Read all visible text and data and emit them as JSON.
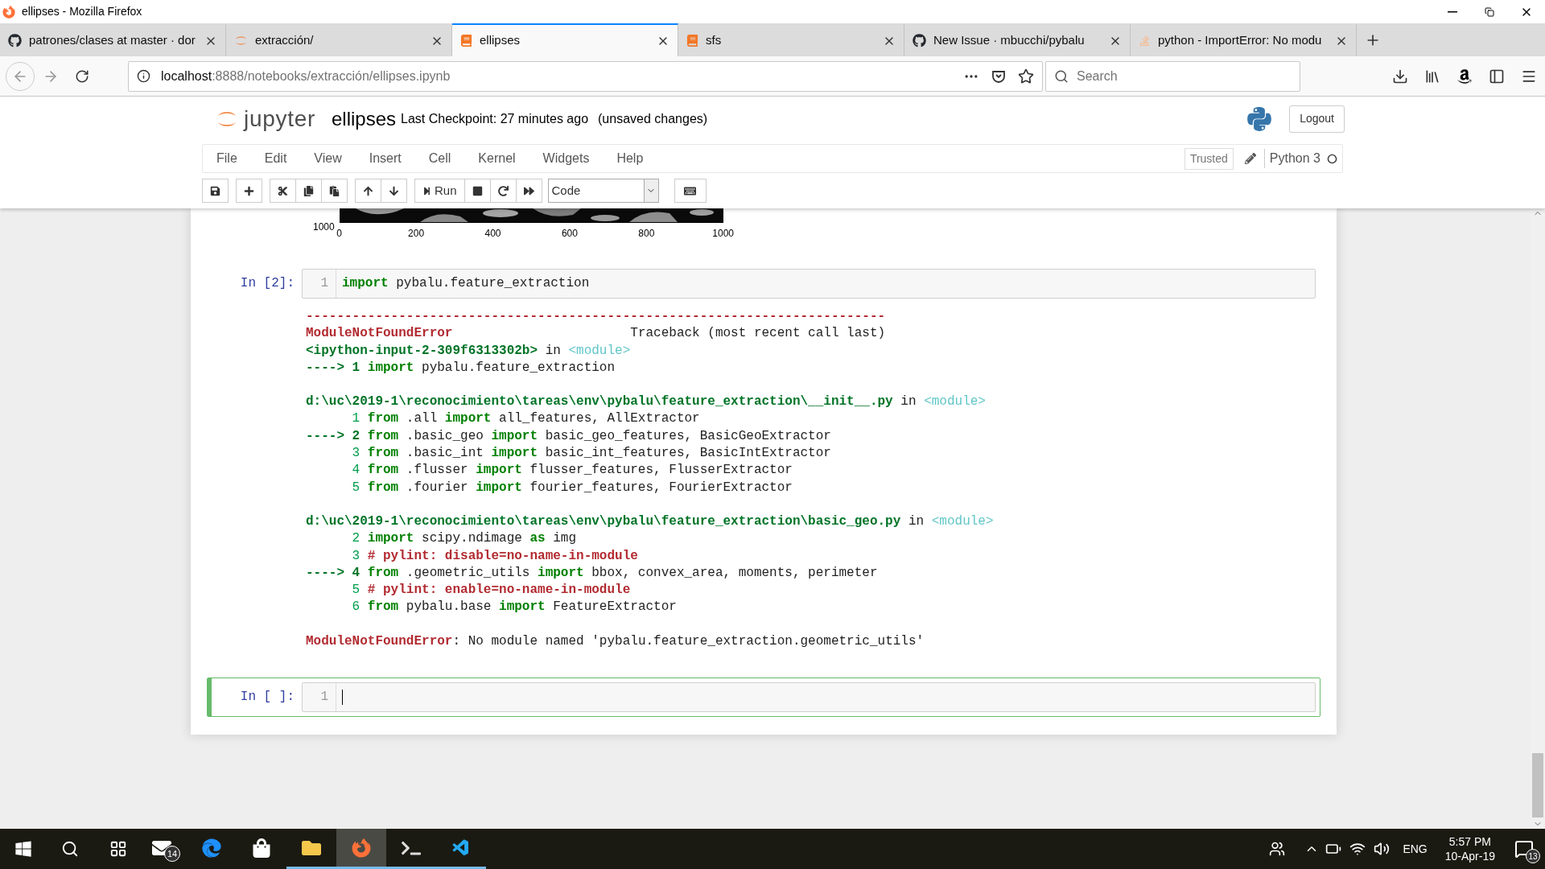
{
  "window": {
    "title": "ellipses - Mozilla Firefox"
  },
  "tabs": [
    {
      "label": "patrones/clases at master · dor",
      "kind": "github",
      "selected": false
    },
    {
      "label": "extracción/",
      "kind": "jupyter",
      "selected": false
    },
    {
      "label": "ellipses",
      "kind": "book",
      "selected": true
    },
    {
      "label": "sfs",
      "kind": "book",
      "selected": false
    },
    {
      "label": "New Issue · mbucchi/pybalu",
      "kind": "github",
      "selected": false
    },
    {
      "label": "python - ImportError: No modu",
      "kind": "stack",
      "selected": false
    }
  ],
  "address_bar": {
    "host": "localhost",
    "path": ":8888/notebooks/extracción/ellipses.ipynb"
  },
  "search": {
    "placeholder": "Search"
  },
  "notebook": {
    "logo": "jupyter",
    "name": "ellipses",
    "checkpoint": "Last Checkpoint: 27 minutes ago",
    "status": "(unsaved changes)",
    "logout": "Logout"
  },
  "menu": [
    "File",
    "Edit",
    "View",
    "Insert",
    "Cell",
    "Kernel",
    "Widgets",
    "Help"
  ],
  "trusted": "Trusted",
  "kernel": "Python 3",
  "toolbar": {
    "run": "Run",
    "cell_type": "Code"
  },
  "plot_axis": {
    "y_tick": "1000",
    "x_ticks": [
      "0",
      "200",
      "400",
      "600",
      "800",
      "1000"
    ]
  },
  "cells": [
    {
      "prompt": "In [2]:",
      "selected": false,
      "lines": [
        {
          "number": "1",
          "tokens": [
            {
              "text": "import",
              "kind": "keyword"
            },
            {
              "text": " pybalu.feature_extraction",
              "kind": "plain"
            }
          ]
        }
      ],
      "output": [
        [
          [
            {
              "text": "---------------------------------------------------------------------------",
              "kind": "error"
            }
          ],
          [
            {
              "text": "ModuleNotFoundError",
              "kind": "error"
            },
            {
              "text": "                       Traceback (most recent call last)",
              "kind": "plain"
            }
          ],
          [
            {
              "text": "<ipython-input-2-309f6313302b>",
              "kind": "frame"
            },
            {
              "text": " in ",
              "kind": "plain"
            },
            {
              "text": "<module>",
              "kind": "module"
            }
          ],
          [
            {
              "text": "----> 1 ",
              "kind": "frame"
            },
            {
              "text": "import",
              "kind": "keyword"
            },
            {
              "text": " pybalu.feature_extraction",
              "kind": "plain"
            }
          ]
        ],
        [
          [
            {
              "text": "d:\\uc\\2019-1\\reconocimiento\\tareas\\env\\pybalu\\feature_extraction\\__init__.py",
              "kind": "frame"
            },
            {
              "text": " in ",
              "kind": "plain"
            },
            {
              "text": "<module>",
              "kind": "module"
            }
          ],
          [
            {
              "text": "      1 ",
              "kind": "lineno"
            },
            {
              "text": "from",
              "kind": "keyword"
            },
            {
              "text": " .all ",
              "kind": "plain"
            },
            {
              "text": "import",
              "kind": "keyword"
            },
            {
              "text": " all_features, AllExtractor",
              "kind": "plain"
            }
          ],
          [
            {
              "text": "----> 2 ",
              "kind": "frame"
            },
            {
              "text": "from",
              "kind": "keyword"
            },
            {
              "text": " .basic_geo ",
              "kind": "plain"
            },
            {
              "text": "import",
              "kind": "keyword"
            },
            {
              "text": " basic_geo_features, BasicGeoExtractor",
              "kind": "plain"
            }
          ],
          [
            {
              "text": "      3 ",
              "kind": "lineno"
            },
            {
              "text": "from",
              "kind": "keyword"
            },
            {
              "text": " .basic_int ",
              "kind": "plain"
            },
            {
              "text": "import",
              "kind": "keyword"
            },
            {
              "text": " basic_int_features, BasicIntExtractor",
              "kind": "plain"
            }
          ],
          [
            {
              "text": "      4 ",
              "kind": "lineno"
            },
            {
              "text": "from",
              "kind": "keyword"
            },
            {
              "text": " .flusser ",
              "kind": "plain"
            },
            {
              "text": "import",
              "kind": "keyword"
            },
            {
              "text": " flusser_features, FlusserExtractor",
              "kind": "plain"
            }
          ],
          [
            {
              "text": "      5 ",
              "kind": "lineno"
            },
            {
              "text": "from",
              "kind": "keyword"
            },
            {
              "text": " .fourier ",
              "kind": "plain"
            },
            {
              "text": "import",
              "kind": "keyword"
            },
            {
              "text": " fourier_features, FourierExtractor",
              "kind": "plain"
            }
          ]
        ],
        [
          [
            {
              "text": "d:\\uc\\2019-1\\reconocimiento\\tareas\\env\\pybalu\\feature_extraction\\basic_geo.py",
              "kind": "frame"
            },
            {
              "text": " in ",
              "kind": "plain"
            },
            {
              "text": "<module>",
              "kind": "module"
            }
          ],
          [
            {
              "text": "      2 ",
              "kind": "lineno"
            },
            {
              "text": "import",
              "kind": "keyword"
            },
            {
              "text": " scipy.ndimage ",
              "kind": "plain"
            },
            {
              "text": "as",
              "kind": "keyword"
            },
            {
              "text": " img",
              "kind": "plain"
            }
          ],
          [
            {
              "text": "      3 ",
              "kind": "lineno"
            },
            {
              "text": "# pylint: disable=no-name-in-module",
              "kind": "error"
            }
          ],
          [
            {
              "text": "----> 4 ",
              "kind": "frame"
            },
            {
              "text": "from",
              "kind": "keyword"
            },
            {
              "text": " .geometric_utils ",
              "kind": "plain"
            },
            {
              "text": "import",
              "kind": "keyword"
            },
            {
              "text": " bbox, convex_area, moments, perimeter",
              "kind": "plain"
            }
          ],
          [
            {
              "text": "      5 ",
              "kind": "lineno"
            },
            {
              "text": "# pylint: enable=no-name-in-module",
              "kind": "error"
            }
          ],
          [
            {
              "text": "      6 ",
              "kind": "lineno"
            },
            {
              "text": "from",
              "kind": "keyword"
            },
            {
              "text": " pybalu.base ",
              "kind": "plain"
            },
            {
              "text": "import",
              "kind": "keyword"
            },
            {
              "text": " FeatureExtractor",
              "kind": "plain"
            }
          ]
        ],
        [
          [
            {
              "text": "ModuleNotFoundError",
              "kind": "error"
            },
            {
              "text": ": No module named 'pybalu.feature_extraction.geometric_utils'",
              "kind": "plain"
            }
          ]
        ]
      ]
    },
    {
      "prompt": "In [ ]:",
      "selected": true,
      "lines": [
        {
          "number": "1"
        }
      ]
    }
  ],
  "taskbar": {
    "apps": [
      {
        "kind": "mail",
        "badge": "14",
        "running": false,
        "selected": false
      },
      {
        "kind": "edge",
        "running": false,
        "selected": false
      },
      {
        "kind": "store",
        "running": false,
        "selected": false
      },
      {
        "kind": "folder",
        "running": true,
        "selected": false
      },
      {
        "kind": "firefox",
        "running": true,
        "selected": true
      },
      {
        "kind": "terminal",
        "running": true,
        "selected": false
      },
      {
        "kind": "vscode",
        "running": true,
        "selected": false
      }
    ],
    "language": "ENG",
    "time": "5:57 PM",
    "date": "10-Apr-19",
    "notifications": "13"
  }
}
